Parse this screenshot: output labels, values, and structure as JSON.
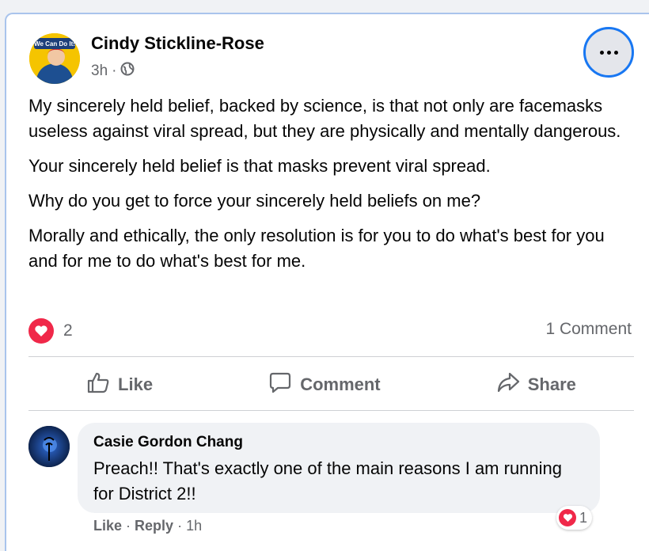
{
  "post": {
    "author": "Cindy Stickline-Rose",
    "avatar_badge": "We Can Do It!",
    "time": "3h",
    "separator": "·",
    "paragraphs": [
      "My sincerely held belief, backed by science, is that not only are facemasks useless against viral spread, but they are physically and mentally dangerous.",
      "Your sincerely held belief is that masks prevent viral spread.",
      "Why do you get to force your sincerely held beliefs on me?",
      "Morally and ethically, the only resolution is for you to do what's best for you and for me to do what's best for me."
    ],
    "reaction_count": "2",
    "comment_count": "1 Comment",
    "actions": {
      "like": "Like",
      "comment": "Comment",
      "share": "Share"
    }
  },
  "comment": {
    "author": "Casie Gordon Chang",
    "text": "Preach!! That's exactly one of the main reasons I am running for District 2!!",
    "like": "Like",
    "reply": "Reply",
    "time": "1h",
    "separator": "·",
    "reaction_count": "1"
  },
  "colors": {
    "accent": "#1877f2",
    "love": "#f02849",
    "muted": "#65676b"
  }
}
